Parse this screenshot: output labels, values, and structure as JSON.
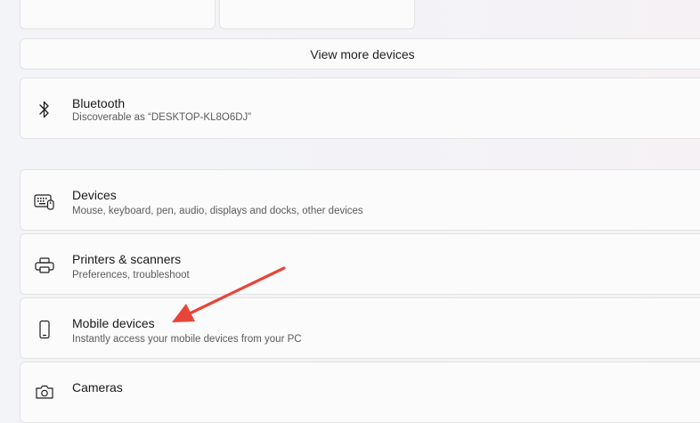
{
  "device_tiles": [
    {
      "label": ""
    },
    {
      "label": ""
    }
  ],
  "view_more": {
    "label": "View more devices"
  },
  "bluetooth": {
    "title": "Bluetooth",
    "subtitle": "Discoverable as “DESKTOP-KL8O6DJ”",
    "icon": "bluetooth-icon"
  },
  "settings_items": [
    {
      "title": "Devices",
      "subtitle": "Mouse, keyboard, pen, audio, displays and docks, other devices",
      "icon": "keyboard-icon"
    },
    {
      "title": "Printers & scanners",
      "subtitle": "Preferences, troubleshoot",
      "icon": "printer-icon"
    },
    {
      "title": "Mobile devices",
      "subtitle": "Instantly access your mobile devices from your PC",
      "icon": "phone-icon"
    },
    {
      "title": "Cameras",
      "subtitle": "",
      "icon": "camera-icon"
    }
  ],
  "annotation": {
    "color": "#e8453a",
    "icon": "arrow-pointer"
  }
}
